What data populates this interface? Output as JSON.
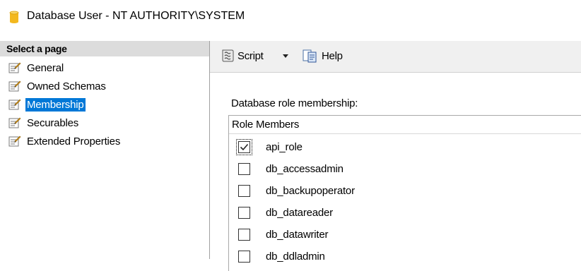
{
  "window": {
    "title": "Database User - NT AUTHORITY\\SYSTEM",
    "icon": "database-icon"
  },
  "left_pane": {
    "header": "Select a page",
    "items": [
      {
        "label": "General",
        "icon": "page-icon",
        "selected": false
      },
      {
        "label": "Owned Schemas",
        "icon": "page-icon",
        "selected": false
      },
      {
        "label": "Membership",
        "icon": "page-icon",
        "selected": true
      },
      {
        "label": "Securables",
        "icon": "page-icon",
        "selected": false
      },
      {
        "label": "Extended Properties",
        "icon": "page-icon",
        "selected": false
      }
    ]
  },
  "toolbar": {
    "script_label": "Script",
    "help_label": "Help"
  },
  "membership": {
    "section_label": "Database role membership:",
    "column_header": "Role Members",
    "roles": [
      {
        "name": "api_role",
        "checked": true
      },
      {
        "name": "db_accessadmin",
        "checked": false
      },
      {
        "name": "db_backupoperator",
        "checked": false
      },
      {
        "name": "db_datareader",
        "checked": false
      },
      {
        "name": "db_datawriter",
        "checked": false
      },
      {
        "name": "db_ddladmin",
        "checked": false
      }
    ]
  },
  "colors": {
    "selection": "#0078d7",
    "header_bg": "#dcdcdc",
    "toolbar_bg": "#f0f0f0",
    "db_icon": "#f3b81f"
  }
}
